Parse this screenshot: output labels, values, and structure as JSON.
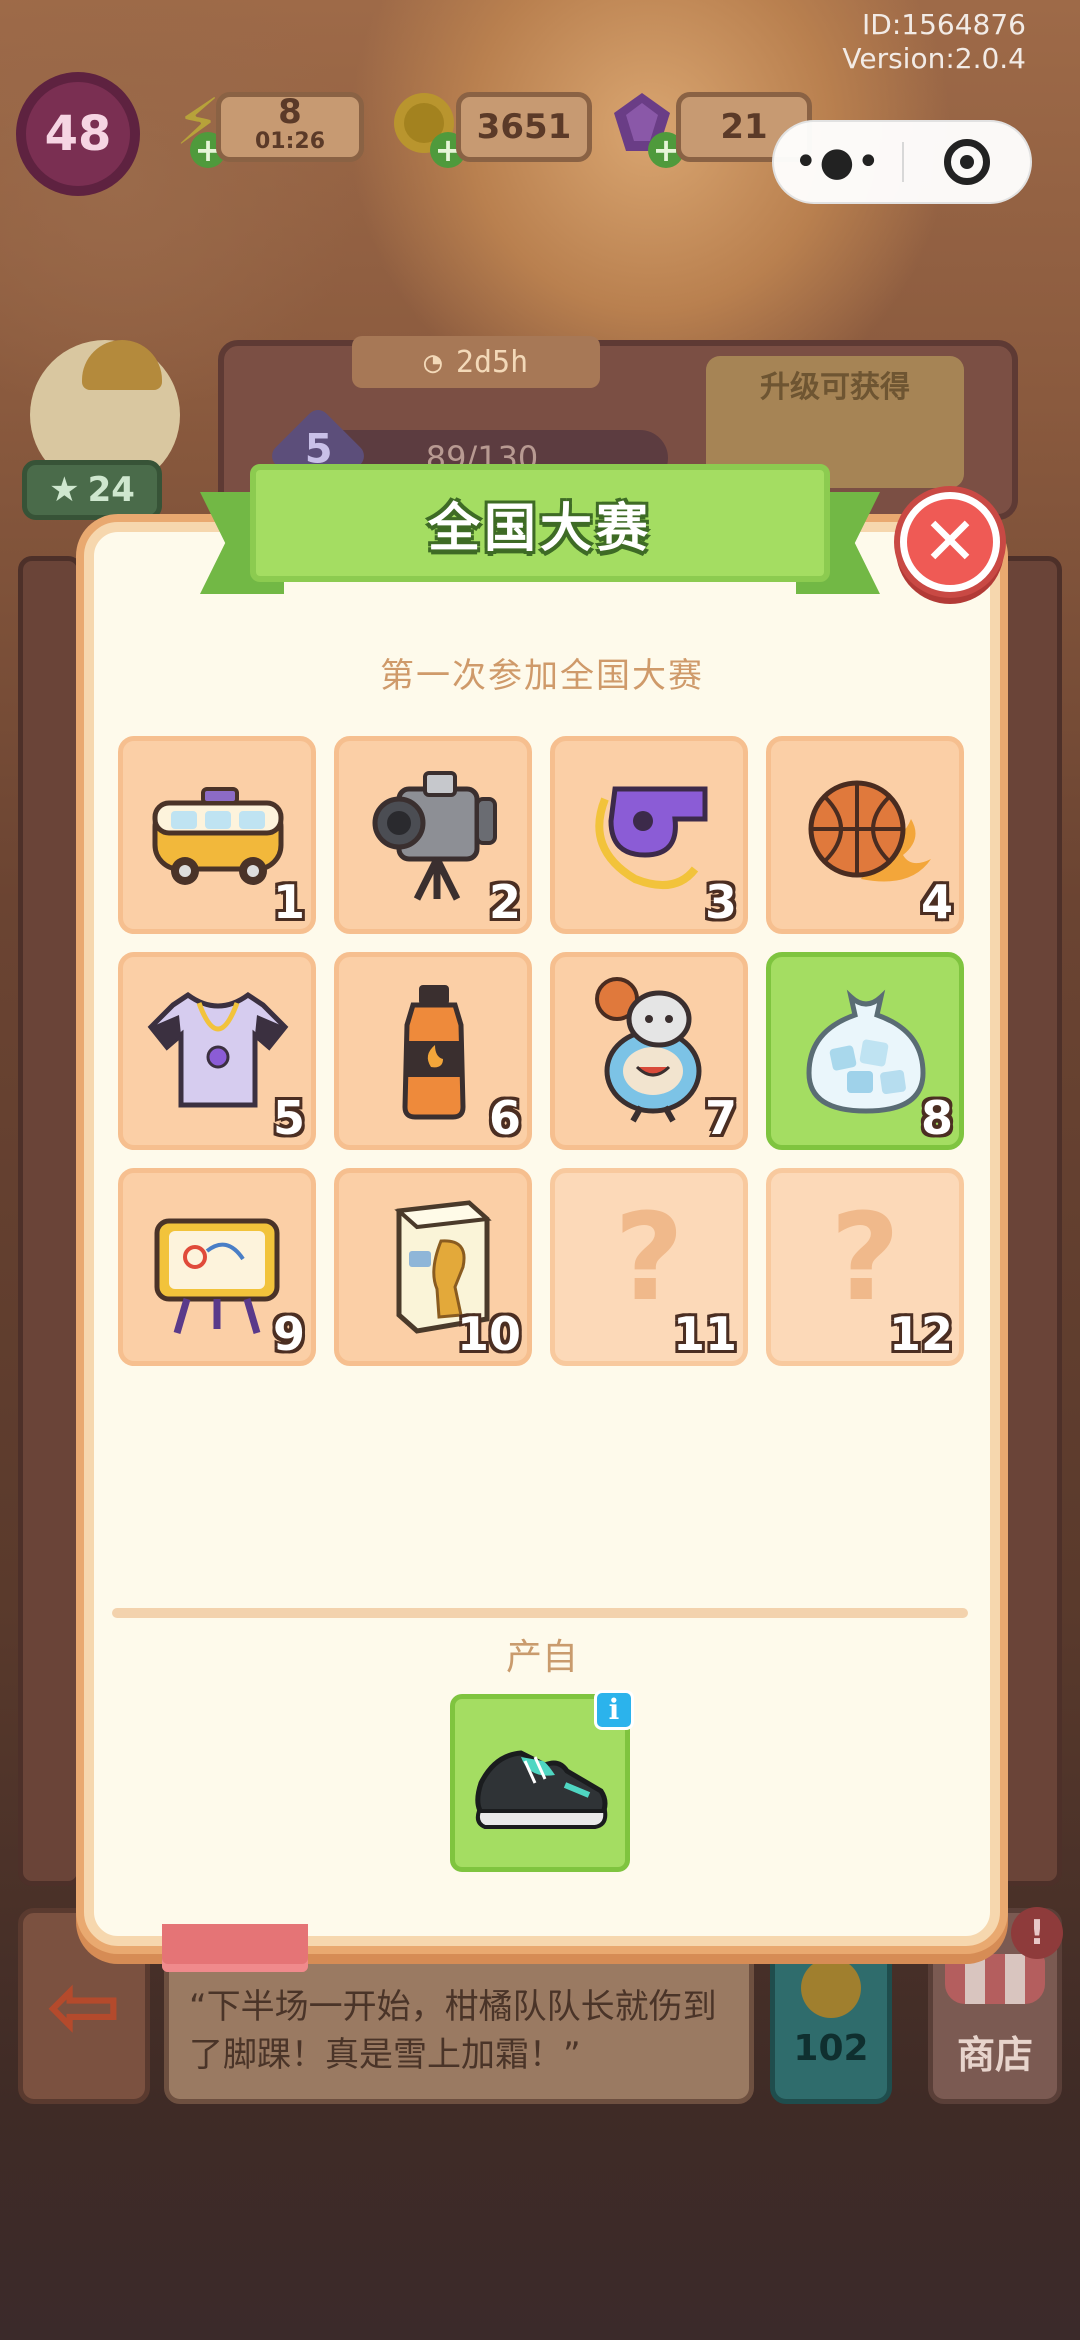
{
  "meta": {
    "id_text": "ID:1564876",
    "version_text": "Version:2.0.4"
  },
  "top_bar": {
    "level": "48",
    "energy": {
      "value": "8",
      "timer": "01:26",
      "icon": "lightning-icon"
    },
    "coins": {
      "value": "3651",
      "icon": "coin-icon"
    },
    "gems": {
      "value": "21",
      "icon": "gem-icon"
    }
  },
  "capsule": {
    "more_icon": "more-dots-icon",
    "close_icon": "target-icon"
  },
  "background": {
    "timer": "2d5h",
    "progress_text": "89/130",
    "stage_level": "5",
    "upgrade_title": "升级可获得",
    "stars": "24",
    "dialog_text": "“下半场一开始，柑橘队队长就伤到了脚踝！真是雪上加霜！”",
    "coin_count": "102",
    "shop_label": "商店",
    "shop_alert": "!"
  },
  "modal": {
    "title": "全国大赛",
    "subtitle": "第一次参加全国大赛",
    "close_icon": "close-icon",
    "items": [
      {
        "number": "1",
        "icon": "van-icon",
        "state": "owned"
      },
      {
        "number": "2",
        "icon": "video-camera-icon",
        "state": "owned"
      },
      {
        "number": "3",
        "icon": "whistle-icon",
        "state": "owned"
      },
      {
        "number": "4",
        "icon": "flaming-basketball-icon",
        "state": "owned"
      },
      {
        "number": "5",
        "icon": "jersey-icon",
        "state": "owned"
      },
      {
        "number": "6",
        "icon": "sports-drink-icon",
        "state": "owned"
      },
      {
        "number": "7",
        "icon": "cat-mascot-icon",
        "state": "owned"
      },
      {
        "number": "8",
        "icon": "ice-bag-icon",
        "state": "selected"
      },
      {
        "number": "9",
        "icon": "tactics-board-icon",
        "state": "owned"
      },
      {
        "number": "10",
        "icon": "trophy-box-icon",
        "state": "owned"
      },
      {
        "number": "11",
        "icon": "question-mark-icon",
        "state": "locked",
        "placeholder": "?"
      },
      {
        "number": "12",
        "icon": "question-mark-icon",
        "state": "locked",
        "placeholder": "?"
      }
    ],
    "source_label": "产自",
    "source_item": {
      "icon": "sneaker-icon",
      "info_icon": "info-icon",
      "info_text": "i"
    }
  },
  "colors": {
    "ribbon_green": "#a4dd62",
    "cell_peach": "#fbcfa6",
    "close_red": "#ef5a55",
    "panel_cream": "#fefaeb"
  }
}
